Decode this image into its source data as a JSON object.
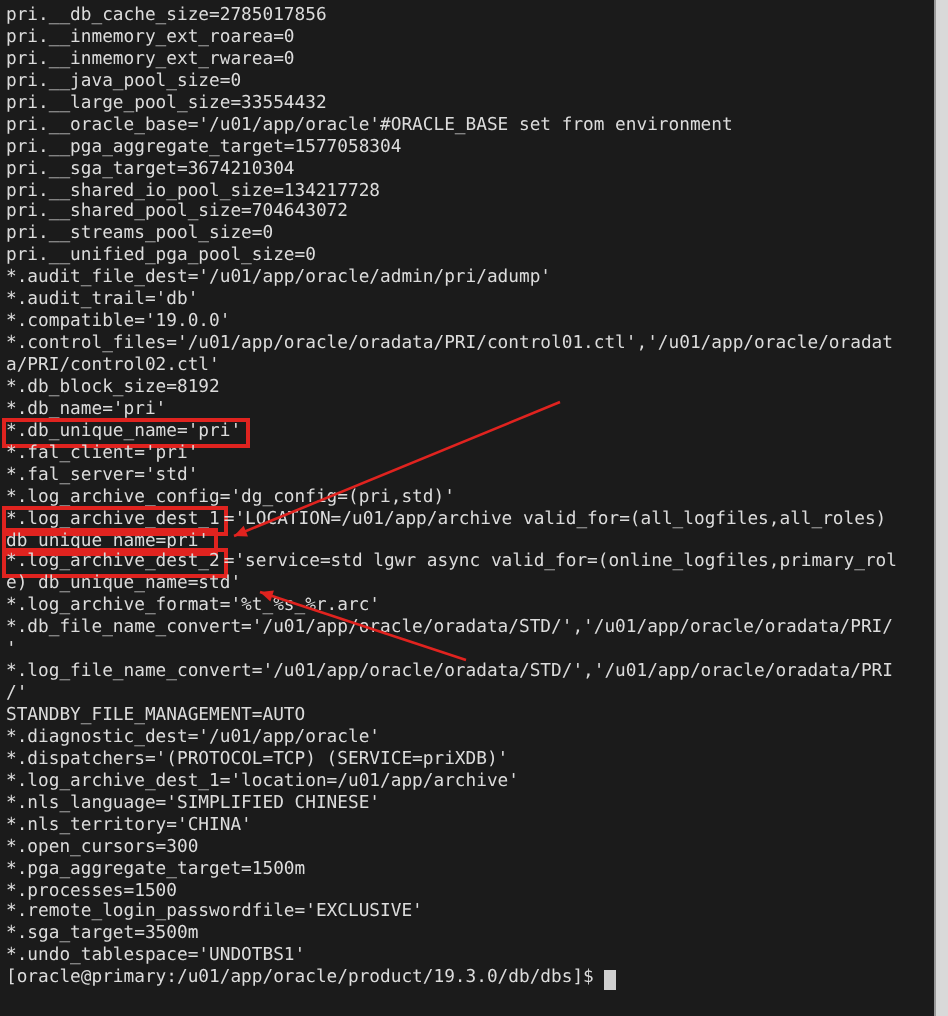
{
  "terminal": {
    "cursor_visible": true,
    "lines": [
      {
        "segments": [
          {
            "text": "pri.__db_cache_size=2785017856",
            "boxed": false
          }
        ]
      },
      {
        "segments": [
          {
            "text": "pri.__inmemory_ext_roarea=0",
            "boxed": false
          }
        ]
      },
      {
        "segments": [
          {
            "text": "pri.__inmemory_ext_rwarea=0",
            "boxed": false
          }
        ]
      },
      {
        "segments": [
          {
            "text": "pri.__java_pool_size=0",
            "boxed": false
          }
        ]
      },
      {
        "segments": [
          {
            "text": "pri.__large_pool_size=33554432",
            "boxed": false
          }
        ]
      },
      {
        "segments": [
          {
            "text": "pri.__oracle_base='/u01/app/oracle'#ORACLE_BASE set from environment",
            "boxed": false
          }
        ]
      },
      {
        "segments": [
          {
            "text": "pri.__pga_aggregate_target=1577058304",
            "boxed": false
          }
        ]
      },
      {
        "segments": [
          {
            "text": "pri.__sga_target=3674210304",
            "boxed": false
          }
        ]
      },
      {
        "segments": [
          {
            "text": "pri.__shared_io_pool_size=134217728",
            "boxed": false
          }
        ]
      },
      {
        "segments": [
          {
            "text": "pri.__shared_pool_size=704643072",
            "boxed": false
          }
        ]
      },
      {
        "segments": [
          {
            "text": "pri.__streams_pool_size=0",
            "boxed": false
          }
        ]
      },
      {
        "segments": [
          {
            "text": "pri.__unified_pga_pool_size=0",
            "boxed": false
          }
        ]
      },
      {
        "segments": [
          {
            "text": "*.audit_file_dest='/u01/app/oracle/admin/pri/adump'",
            "boxed": false
          }
        ]
      },
      {
        "segments": [
          {
            "text": "*.audit_trail='db'",
            "boxed": false
          }
        ]
      },
      {
        "segments": [
          {
            "text": "*.compatible='19.0.0'",
            "boxed": false
          }
        ]
      },
      {
        "segments": [
          {
            "text": "*.control_files='/u01/app/oracle/oradata/PRI/control01.ctl','/u01/app/oracle/oradat",
            "boxed": false
          }
        ]
      },
      {
        "segments": [
          {
            "text": "a/PRI/control02.ctl'",
            "boxed": false
          }
        ]
      },
      {
        "segments": [
          {
            "text": "*.db_block_size=8192",
            "boxed": false
          }
        ]
      },
      {
        "segments": [
          {
            "text": "*.db_name='pri'",
            "boxed": false
          }
        ]
      },
      {
        "segments": [
          {
            "text": "*.db_unique_name='pri'",
            "boxed": true
          }
        ]
      },
      {
        "segments": [
          {
            "text": "*.fal_client='pri'",
            "boxed": false
          }
        ]
      },
      {
        "segments": [
          {
            "text": "*.fal_server='std'",
            "boxed": false
          }
        ]
      },
      {
        "segments": [
          {
            "text": "*.log_archive_config='dg_config=(pri,std)'",
            "boxed": false
          }
        ]
      },
      {
        "segments": [
          {
            "text": "*.log_archive_dest_1",
            "boxed": true
          },
          {
            "text": "='LOCATION=/u01/app/archive valid_for=(all_logfiles,all_roles)",
            "boxed": false
          }
        ]
      },
      {
        "segments": [
          {
            "text": "db_unique_name=pri'",
            "boxed": true
          }
        ]
      },
      {
        "segments": [
          {
            "text": "*.log_archive_dest_2",
            "boxed": true
          },
          {
            "text": "='service=std lgwr async valid_for=(online_logfiles,primary_rol",
            "boxed": false
          }
        ]
      },
      {
        "segments": [
          {
            "text": "e) db_unique_name=std'",
            "boxed": false
          }
        ]
      },
      {
        "segments": [
          {
            "text": "*.log_archive_format='%t_%s_%r.arc'",
            "boxed": false
          }
        ]
      },
      {
        "segments": [
          {
            "text": "*.db_file_name_convert='/u01/app/oracle/oradata/STD/','/u01/app/oracle/oradata/PRI/",
            "boxed": false
          }
        ]
      },
      {
        "segments": [
          {
            "text": "'",
            "boxed": false
          }
        ]
      },
      {
        "segments": [
          {
            "text": "*.log_file_name_convert='/u01/app/oracle/oradata/STD/','/u01/app/oracle/oradata/PRI",
            "boxed": false
          }
        ]
      },
      {
        "segments": [
          {
            "text": "/'",
            "boxed": false
          }
        ]
      },
      {
        "segments": [
          {
            "text": "STANDBY_FILE_MANAGEMENT=AUTO",
            "boxed": false
          }
        ]
      },
      {
        "segments": [
          {
            "text": "*.diagnostic_dest='/u01/app/oracle'",
            "boxed": false
          }
        ]
      },
      {
        "segments": [
          {
            "text": "*.dispatchers='(PROTOCOL=TCP) (SERVICE=priXDB)'",
            "boxed": false
          }
        ]
      },
      {
        "segments": [
          {
            "text": "*.log_archive_dest_1='location=/u01/app/archive'",
            "boxed": false
          }
        ]
      },
      {
        "segments": [
          {
            "text": "*.nls_language='SIMPLIFIED CHINESE'",
            "boxed": false
          }
        ]
      },
      {
        "segments": [
          {
            "text": "*.nls_territory='CHINA'",
            "boxed": false
          }
        ]
      },
      {
        "segments": [
          {
            "text": "*.open_cursors=300",
            "boxed": false
          }
        ]
      },
      {
        "segments": [
          {
            "text": "*.pga_aggregate_target=1500m",
            "boxed": false
          }
        ]
      },
      {
        "segments": [
          {
            "text": "*.processes=1500",
            "boxed": false
          }
        ]
      },
      {
        "segments": [
          {
            "text": "*.remote_login_passwordfile='EXCLUSIVE'",
            "boxed": false
          }
        ]
      },
      {
        "segments": [
          {
            "text": "*.sga_target=3500m",
            "boxed": false
          }
        ]
      },
      {
        "segments": [
          {
            "text": "*.undo_tablespace='UNDOTBS1'",
            "boxed": false
          }
        ]
      },
      {
        "segments": [
          {
            "text": "[oracle@primary:/u01/app/oracle/product/19.3.0/db/dbs]$",
            "boxed": false
          }
        ]
      }
    ]
  }
}
